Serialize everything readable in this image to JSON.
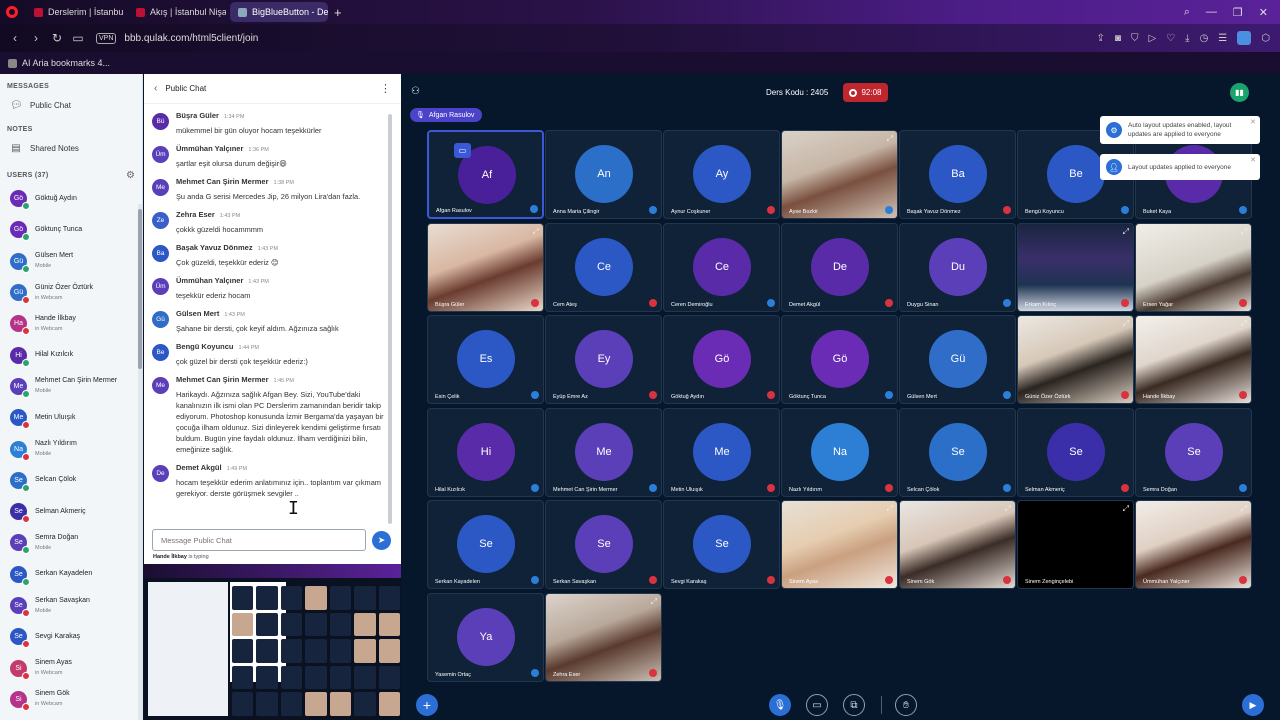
{
  "browser": {
    "tabs": [
      {
        "label": "Derslerim | İstanbul Nişant..."
      },
      {
        "label": "Akış | İstanbul Nişantaşı Ü..."
      },
      {
        "label": "BigBlueButton - Ders"
      }
    ],
    "url": "bbb.qulak.com/html5client/join",
    "vpn_label": "VPN",
    "bookmark": "AI Aria bookmarks 4..."
  },
  "sidebar": {
    "messages_title": "MESSAGES",
    "public_chat": "Public Chat",
    "notes_title": "NOTES",
    "shared_notes": "Shared Notes",
    "users_title": "USERS (37)",
    "users": [
      {
        "initials": "Gö",
        "name": "Göktuğ Aydın",
        "sub": "",
        "color": "#6a2bb5",
        "status": "teal"
      },
      {
        "initials": "Gö",
        "name": "Göktunç Tunca",
        "sub": "",
        "color": "#6a2bb5",
        "status": "teal"
      },
      {
        "initials": "Gü",
        "name": "Gülsen Mert",
        "sub": "Mobile",
        "color": "#2f6dc9",
        "status": "teal"
      },
      {
        "initials": "Gü",
        "name": "Güniz Özer Öztürk",
        "sub": "in Webcam",
        "color": "#2f6dc9",
        "status": "red"
      },
      {
        "initials": "Ha",
        "name": "Hande İlkbay",
        "sub": "in Webcam",
        "color": "#b5348a",
        "status": "red"
      },
      {
        "initials": "Hi",
        "name": "Hilal Kızılcık",
        "sub": "",
        "color": "#5a2ba8",
        "status": "teal"
      },
      {
        "initials": "Me",
        "name": "Mehmet Can Şirin Mermer",
        "sub": "Mobile",
        "color": "#5a3fb8",
        "status": "teal"
      },
      {
        "initials": "Me",
        "name": "Metin Uluışık",
        "sub": "",
        "color": "#2b58c4",
        "status": "red"
      },
      {
        "initials": "Na",
        "name": "Nazlı Yıldırım",
        "sub": "Mobile",
        "color": "#2d7fd6",
        "status": "red"
      },
      {
        "initials": "Se",
        "name": "Selcan Çölok",
        "sub": "",
        "color": "#2b6fc9",
        "status": "teal"
      },
      {
        "initials": "Se",
        "name": "Selman Akmeriç",
        "sub": "",
        "color": "#3a2fa8",
        "status": "red"
      },
      {
        "initials": "Se",
        "name": "Semra Doğan",
        "sub": "Mobile",
        "color": "#5a3fb8",
        "status": "teal"
      },
      {
        "initials": "Se",
        "name": "Serkan Kayadelen",
        "sub": "",
        "color": "#2b58c4",
        "status": "teal"
      },
      {
        "initials": "Se",
        "name": "Serkan Savaşkan",
        "sub": "Mobile",
        "color": "#5a3fb8",
        "status": "red"
      },
      {
        "initials": "Se",
        "name": "Sevgi Karakaş",
        "sub": "",
        "color": "#2b58c4",
        "status": "red"
      },
      {
        "initials": "Si",
        "name": "Sinem Ayas",
        "sub": "in Webcam",
        "color": "#c23b6a",
        "status": "red"
      },
      {
        "initials": "Si",
        "name": "Sinem Gök",
        "sub": "in Webcam",
        "color": "#b5348a",
        "status": "red"
      }
    ]
  },
  "chat": {
    "title": "Public Chat",
    "input_placeholder": "Message Public Chat",
    "typing_name": "Hande İlkbay",
    "typing_suffix": "is typing",
    "messages": [
      {
        "initials": "Bü",
        "name": "Büşra Güler",
        "time": "1:34 PM",
        "text": "mükemmel bir gün oluyor hocam teşekkürler",
        "color": "#5a2ba8"
      },
      {
        "initials": "Üm",
        "name": "Ümmühan Yalçıner",
        "time": "1:36 PM",
        "text": "şartlar eşit olursa durum değişir😄",
        "color": "#5a3fb8"
      },
      {
        "initials": "Me",
        "name": "Mehmet Can Şirin Mermer",
        "time": "1:38 PM",
        "text": "Şu anda G serisi Mercedes Jip, 26 milyon Lira'dan fazla.",
        "color": "#5a3fb8"
      },
      {
        "initials": "Ze",
        "name": "Zehra Eser",
        "time": "1:43 PM",
        "text": "çokkk güzeldi hocammmm",
        "color": "#3a5fc9"
      },
      {
        "initials": "Ba",
        "name": "Başak Yavuz Dönmez",
        "time": "1:43 PM",
        "text": "Çok güzeldi, teşekkür ederiz 😊",
        "color": "#2b58c4"
      },
      {
        "initials": "Üm",
        "name": "Ümmühan Yalçıner",
        "time": "1:43 PM",
        "text": "teşekkür ederiz hocam",
        "color": "#5a3fb8"
      },
      {
        "initials": "Gü",
        "name": "Gülsen Mert",
        "time": "1:43 PM",
        "text": "Şahane bir dersti, çok keyif aldım. Ağzınıza sağlık",
        "color": "#2f6dc9"
      },
      {
        "initials": "Be",
        "name": "Bengü Koyuncu",
        "time": "1:44 PM",
        "text": "çok güzel bir dersti çok teşekkür ederiz:)",
        "color": "#2b58c4"
      },
      {
        "initials": "Me",
        "name": "Mehmet Can Şirin Mermer",
        "time": "1:45 PM",
        "text": "Harikaydı. Ağzınıza sağlık Afgan Bey. Sizi, YouTube'daki kanalınızın ilk ismi olan PC Derslerim zamanından beridir takip ediyorum. Photoshop konusunda İzmir Bergama'da yaşayan bir çocuğa ilham oldunuz. Sizi dinleyerek kendimi geliştirme fırsatı buldum. Bugün yine faydalı oldunuz. İlham verdiğinizi bilin, emeğinize sağlık.",
        "color": "#5a3fb8"
      },
      {
        "initials": "De",
        "name": "Demet Akgül",
        "time": "1:49 PM",
        "text": "hocam teşekkür ederim anlatımınız için.. toplantım var çıkmam gerekiyor. derste görüşmek sevgiler ..",
        "color": "#5a3fb8"
      }
    ]
  },
  "meeting": {
    "room_label": "Ders Kodu : 2405",
    "rec_time": "92:08",
    "presenter": "Afgan Rasulov",
    "toasts": [
      "Auto layout updates enabled, layout updates are applied to everyone",
      "Layout updates applied to everyone"
    ],
    "tiles": [
      {
        "type": "presenter",
        "initials": "Af",
        "name": "Afgan Rasulov",
        "color": "#4a1f9a",
        "mic": "blue"
      },
      {
        "type": "avatar",
        "initials": "An",
        "name": "Anna Maria Çilingir",
        "color": "#2b6fc9",
        "mic": "blue"
      },
      {
        "type": "avatar",
        "initials": "Ay",
        "name": "Aynur Coşkuner",
        "color": "#2b58c4",
        "mic": "red"
      },
      {
        "type": "video",
        "name": "Ayse Bozkir",
        "bg": "linear-gradient(160deg,#d9d2c8 0%,#c7b6a6 40%,#7a5040 60%,#d0c2b4 100%)",
        "mic": "blue"
      },
      {
        "type": "avatar",
        "initials": "Ba",
        "name": "Başak Yavuz Dönmez",
        "color": "#2b58c4",
        "mic": "red"
      },
      {
        "type": "avatar",
        "initials": "Be",
        "name": "Bengü Koyuncu",
        "color": "#2b58c4",
        "mic": "blue"
      },
      {
        "type": "avatar",
        "initials": "Bu",
        "name": "Buket Kaya",
        "color": "#5a2ba8",
        "mic": "blue"
      },
      {
        "type": "video",
        "name": "Büşra Güler",
        "bg": "linear-gradient(160deg,#e8ddd2 0%,#d9b7a3 40%,#6a3c30 60%,#ead8c8 100%)",
        "mic": "red"
      },
      {
        "type": "avatar",
        "initials": "Ce",
        "name": "Cem Ateş",
        "color": "#2b58c4",
        "mic": "red"
      },
      {
        "type": "avatar",
        "initials": "Ce",
        "name": "Ceren Demiroğlu",
        "color": "#5a2ba8",
        "mic": "blue"
      },
      {
        "type": "avatar",
        "initials": "De",
        "name": "Demet Akgül",
        "color": "#5a2ba8",
        "mic": "red"
      },
      {
        "type": "avatar",
        "initials": "Du",
        "name": "Duygu Sinan",
        "color": "#5a3fb8",
        "mic": "blue"
      },
      {
        "type": "video",
        "name": "Erkam Kılınç",
        "bg": "linear-gradient(180deg,#1a2540 0%,#3a2f6a 40%,#1f3352 70%,#cfd6e0 100%)",
        "mic": "red"
      },
      {
        "type": "video",
        "name": "Ersen Yağar",
        "bg": "linear-gradient(160deg,#f0eee8 0%,#d7d2c8 50%,#4a3a30 70%,#e6e2da 100%)",
        "mic": "red"
      },
      {
        "type": "avatar",
        "initials": "Es",
        "name": "Esin Çelik",
        "color": "#2b58c4",
        "mic": "blue"
      },
      {
        "type": "avatar",
        "initials": "Ey",
        "name": "Eyüp Emre Az",
        "color": "#5a3fb8",
        "mic": "red"
      },
      {
        "type": "avatar",
        "initials": "Gö",
        "name": "Göktuğ Aydın",
        "color": "#6a2bb5",
        "mic": "red"
      },
      {
        "type": "avatar",
        "initials": "Gö",
        "name": "Göktunç Tunca",
        "color": "#6a2bb5",
        "mic": "blue"
      },
      {
        "type": "avatar",
        "initials": "Gü",
        "name": "Gülsen Mert",
        "color": "#2f6dc9",
        "mic": "blue"
      },
      {
        "type": "video",
        "name": "Güniz Özer Öztürk",
        "bg": "linear-gradient(160deg,#ece8e2 0%,#d6c8b8 40%,#2a2420 60%,#d9cdbf 100%)",
        "mic": "red"
      },
      {
        "type": "video",
        "name": "Hande İlkbay",
        "bg": "linear-gradient(160deg,#f3f0ec 0%,#e0d6cc 40%,#3a2a22 60%,#e8e2dc 100%)",
        "mic": "red"
      },
      {
        "type": "avatar",
        "initials": "Hi",
        "name": "Hilal Kızılcık",
        "color": "#5a2ba8",
        "mic": "blue"
      },
      {
        "type": "avatar",
        "initials": "Me",
        "name": "Mehmet Can Şirin Mermer",
        "color": "#5a3fb8",
        "mic": "blue"
      },
      {
        "type": "avatar",
        "initials": "Me",
        "name": "Metin Uluışık",
        "color": "#2b58c4",
        "mic": "red"
      },
      {
        "type": "avatar",
        "initials": "Na",
        "name": "Nazlı Yıldırım",
        "color": "#2d7fd6",
        "mic": "red"
      },
      {
        "type": "avatar",
        "initials": "Se",
        "name": "Selcan Çölok",
        "color": "#2b6fc9",
        "mic": "blue"
      },
      {
        "type": "avatar",
        "initials": "Se",
        "name": "Selman Akmeriç",
        "color": "#3a2fa8",
        "mic": "red"
      },
      {
        "type": "avatar",
        "initials": "Se",
        "name": "Semra Doğan",
        "color": "#5a3fb8",
        "mic": "blue"
      },
      {
        "type": "avatar",
        "initials": "Se",
        "name": "Serkan Kayadelen",
        "color": "#2b58c4",
        "mic": "blue"
      },
      {
        "type": "avatar",
        "initials": "Se",
        "name": "Serkan Savaşkan",
        "color": "#5a3fb8",
        "mic": "red"
      },
      {
        "type": "avatar",
        "initials": "Se",
        "name": "Sevgi Karakaş",
        "color": "#2b58c4",
        "mic": "red"
      },
      {
        "type": "video",
        "name": "Sinem Ayas",
        "bg": "linear-gradient(160deg,#e8e0d6 0%,#e6cdb0 40%,#caa080 60%,#efe6dc 100%)",
        "mic": "red"
      },
      {
        "type": "video",
        "name": "Sinem Gök",
        "bg": "linear-gradient(160deg,#eae6e2 0%,#d8c6b8 40%,#3a2c26 60%,#e4dcd4 100%)",
        "mic": "red"
      },
      {
        "type": "video",
        "name": "Sinem Zenginçelebi",
        "bg": "#000000",
        "mic": "none"
      },
      {
        "type": "video",
        "name": "Ümmühan Yalçıner",
        "bg": "linear-gradient(160deg,#f2ede8 0%,#e0d0c4 40%,#4a2a20 60%,#eae2da 100%)",
        "mic": "red"
      },
      {
        "type": "avatar",
        "initials": "Ya",
        "name": "Yasemin Ortaç",
        "color": "#5a3fb8",
        "mic": "blue"
      },
      {
        "type": "video",
        "name": "Zehra Eser",
        "bg": "linear-gradient(160deg,#dcd4cc 0%,#b8a89a 40%,#5a3a2e 60%,#cbbfb4 100%)",
        "mic": "red"
      }
    ]
  }
}
